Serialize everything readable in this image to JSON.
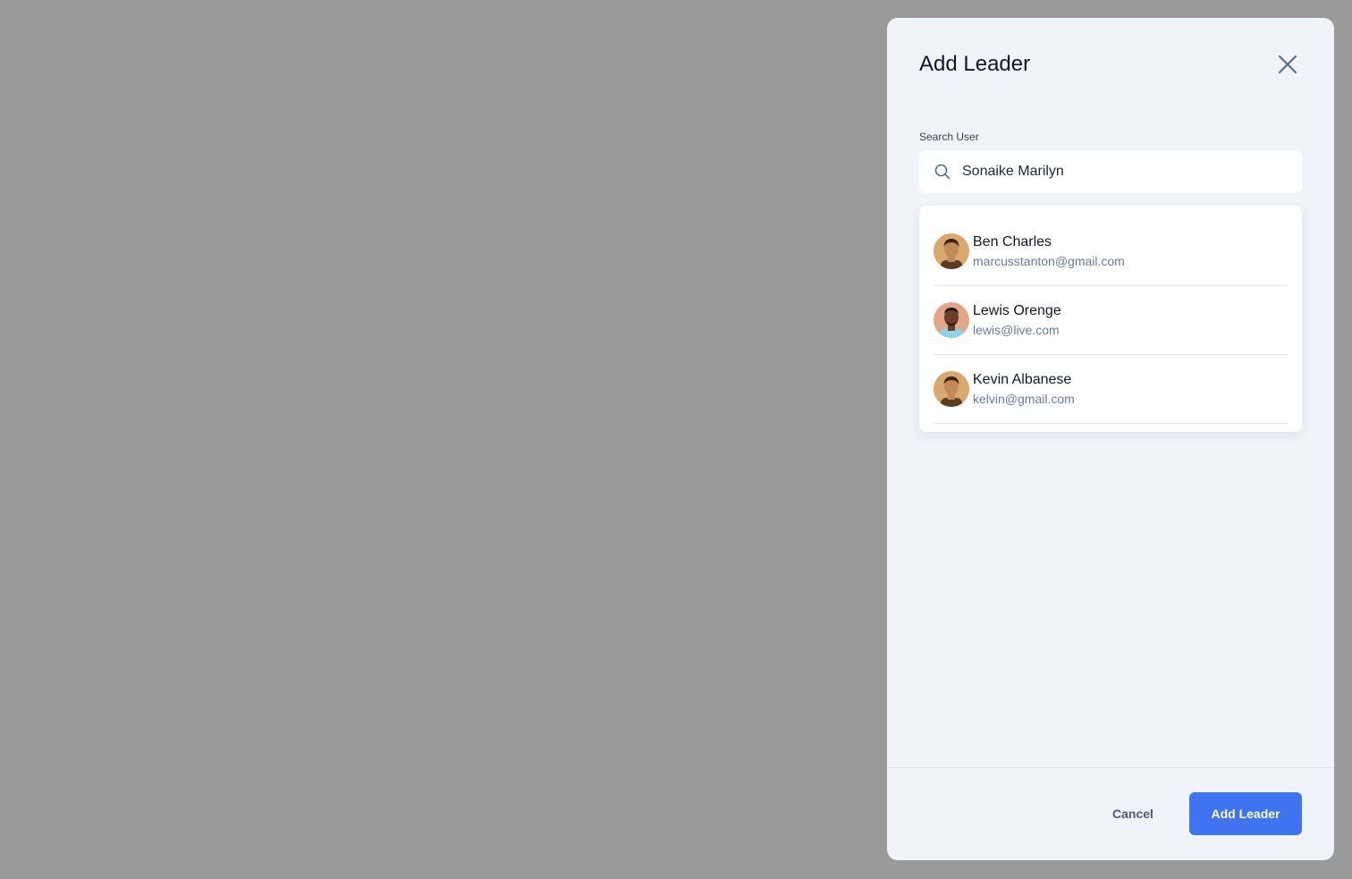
{
  "panel": {
    "title": "Add Leader",
    "close_icon": "close-icon"
  },
  "search": {
    "label": "Search User",
    "value": "Sonaike Marilyn",
    "icon": "search-icon"
  },
  "results": [
    {
      "name": "Ben Charles",
      "email": "marcusstanton@gmail.com",
      "avatar_skin": "#c08a5a",
      "avatar_bg": "#d9a86f",
      "avatar_hair": "#3a2416",
      "avatar_shirt": "#5c3b24"
    },
    {
      "name": "Lewis Orenge",
      "email": "lewis@live.com",
      "avatar_skin": "#6b3e26",
      "avatar_bg": "#e0a78a",
      "avatar_hair": "#1c120c",
      "avatar_shirt": "#8fd3e6"
    },
    {
      "name": "Kevin Albanese",
      "email": "kelvin@gmail.com",
      "avatar_skin": "#c08a5a",
      "avatar_bg": "#d9a86f",
      "avatar_hair": "#3a2416",
      "avatar_shirt": "#5c3b24"
    }
  ],
  "footer": {
    "cancel_label": "Cancel",
    "submit_label": "Add Leader"
  },
  "colors": {
    "overlay": "#9a9a9a",
    "panel_bg": "#f0f4f9",
    "primary": "#3f73f0",
    "text_muted": "#6b7a99"
  }
}
